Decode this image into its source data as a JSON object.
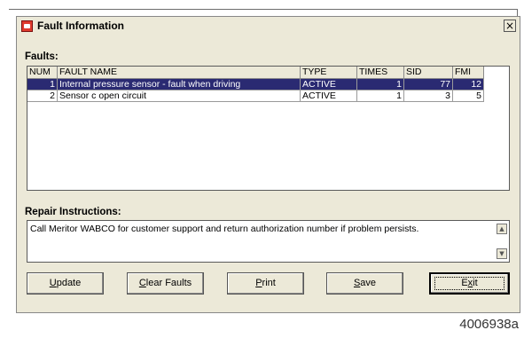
{
  "window": {
    "title": "Fault Information",
    "close_label": "×"
  },
  "faults_label": "Faults:",
  "columns": [
    "NUM",
    "FAULT NAME",
    "TYPE",
    "TIMES",
    "SID",
    "FMI"
  ],
  "rows": [
    {
      "num": "1",
      "name": "Internal pressure sensor - fault when driving",
      "type": "ACTIVE",
      "times": "1",
      "sid": "77",
      "fmi": "12",
      "selected": true
    },
    {
      "num": "2",
      "name": "Sensor c open circuit",
      "type": "ACTIVE",
      "times": "1",
      "sid": "3",
      "fmi": "5",
      "selected": false
    }
  ],
  "repair": {
    "label": "Repair Instructions:",
    "text": "Call Meritor WABCO for customer support and return authorization number if problem persists."
  },
  "buttons": {
    "update": {
      "accel": "U",
      "rest": "pdate"
    },
    "clear": {
      "accel": "C",
      "rest": "lear Faults"
    },
    "print": {
      "accel": "P",
      "rest": "rint"
    },
    "save": {
      "accel": "S",
      "rest": "ave"
    },
    "exit": {
      "pre": "E",
      "accel": "x",
      "rest": "it"
    }
  },
  "figure_id": "4006938a",
  "colors": {
    "dialog_bg": "#ece9d8",
    "selection": "#2a2a72",
    "title_icon": "#e03a2d"
  }
}
